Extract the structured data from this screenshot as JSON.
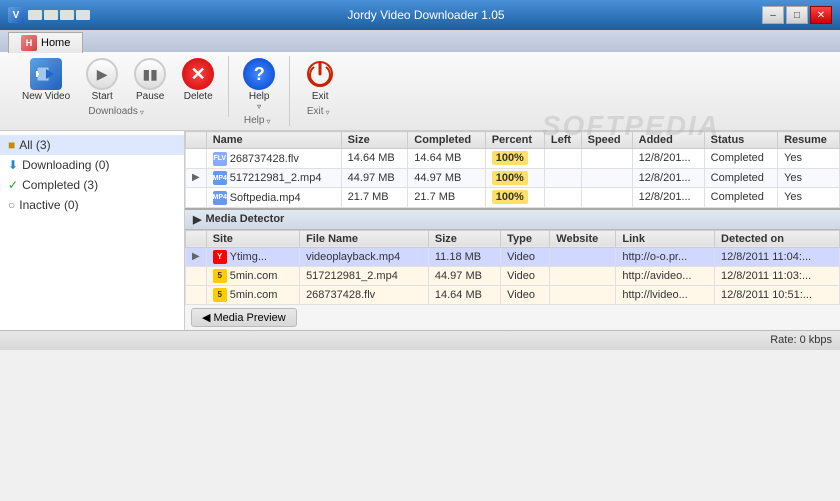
{
  "titleBar": {
    "title": "Jordy Video Downloader 1.05",
    "controls": [
      "minimize",
      "maximize",
      "close"
    ]
  },
  "ribbon": {
    "tabs": [
      {
        "label": "Home",
        "active": true
      }
    ],
    "groups": [
      {
        "name": "downloads",
        "label": "Downloads",
        "buttons": [
          {
            "id": "new-video",
            "label": "New Video",
            "icon": "film"
          },
          {
            "id": "start",
            "label": "Start",
            "icon": "play"
          },
          {
            "id": "pause",
            "label": "Pause",
            "icon": "pause"
          },
          {
            "id": "delete",
            "label": "Delete",
            "icon": "x"
          }
        ]
      },
      {
        "name": "help-group",
        "label": "Help",
        "buttons": [
          {
            "id": "help",
            "label": "Help ▾",
            "icon": "?"
          }
        ]
      },
      {
        "name": "exit-group",
        "label": "Exit",
        "buttons": [
          {
            "id": "exit",
            "label": "Exit",
            "icon": "power"
          }
        ]
      }
    ]
  },
  "sidebar": {
    "items": [
      {
        "id": "all",
        "label": "All (3)",
        "icon": "all",
        "selected": true
      },
      {
        "id": "downloading",
        "label": "Downloading (0)",
        "icon": "downloading"
      },
      {
        "id": "completed",
        "label": "Completed (3)",
        "icon": "completed"
      },
      {
        "id": "inactive",
        "label": "Inactive (0)",
        "icon": "inactive"
      }
    ]
  },
  "downloadsTable": {
    "columns": [
      "",
      "Name",
      "Size",
      "Completed",
      "Percent",
      "Left",
      "Speed",
      "Added",
      "Status",
      "Resume"
    ],
    "rows": [
      {
        "arrow": "",
        "icon": "flv",
        "name": "268737428.flv",
        "size": "14.64 MB",
        "completed": "14.64 MB",
        "percent": "100%",
        "left": "",
        "speed": "",
        "added": "12/8/201...",
        "status": "Completed",
        "resume": "Yes"
      },
      {
        "arrow": "▶",
        "icon": "mp4",
        "name": "517212981_2.mp4",
        "size": "44.97 MB",
        "completed": "44.97 MB",
        "percent": "100%",
        "left": "",
        "speed": "",
        "added": "12/8/201...",
        "status": "Completed",
        "resume": "Yes"
      },
      {
        "arrow": "",
        "icon": "mp4",
        "name": "Softpedia.mp4",
        "size": "21.7 MB",
        "completed": "21.7 MB",
        "percent": "100%",
        "left": "",
        "speed": "",
        "added": "12/8/201...",
        "status": "Completed",
        "resume": "Yes"
      }
    ]
  },
  "mediaDetector": {
    "title": "Media Detector",
    "columns": [
      "",
      "Site",
      "File Name",
      "Size",
      "Type",
      "Website",
      "Link",
      "Detected on"
    ],
    "rows": [
      {
        "arrow": "▶",
        "site": "Ytimg...",
        "siteType": "ytimg",
        "fileName": "videoplayback.mp4",
        "size": "11.18 MB",
        "type": "Video",
        "website": "",
        "link": "http://o-o.pr...",
        "detectedOn": "12/8/2011 11:04:...",
        "rowClass": "md-selected"
      },
      {
        "arrow": "",
        "site": "5min.com",
        "siteType": "fivemin",
        "fileName": "517212981_2.mp4",
        "size": "44.97 MB",
        "type": "Video",
        "website": "",
        "link": "http://avideo...",
        "detectedOn": "12/8/2011 11:03:...",
        "rowClass": "md-row2"
      },
      {
        "arrow": "",
        "site": "5min.com",
        "siteType": "fivemin",
        "fileName": "268737428.flv",
        "size": "14.64 MB",
        "type": "Video",
        "website": "",
        "link": "http://lvideo...",
        "detectedOn": "12/8/2011 10:51:...",
        "rowClass": "md-row3"
      }
    ]
  },
  "mediaPreview": {
    "label": "◀ Media Preview"
  },
  "statusBar": {
    "rate": "Rate: 0 kbps"
  },
  "watermark": "SOFTPEDIA"
}
